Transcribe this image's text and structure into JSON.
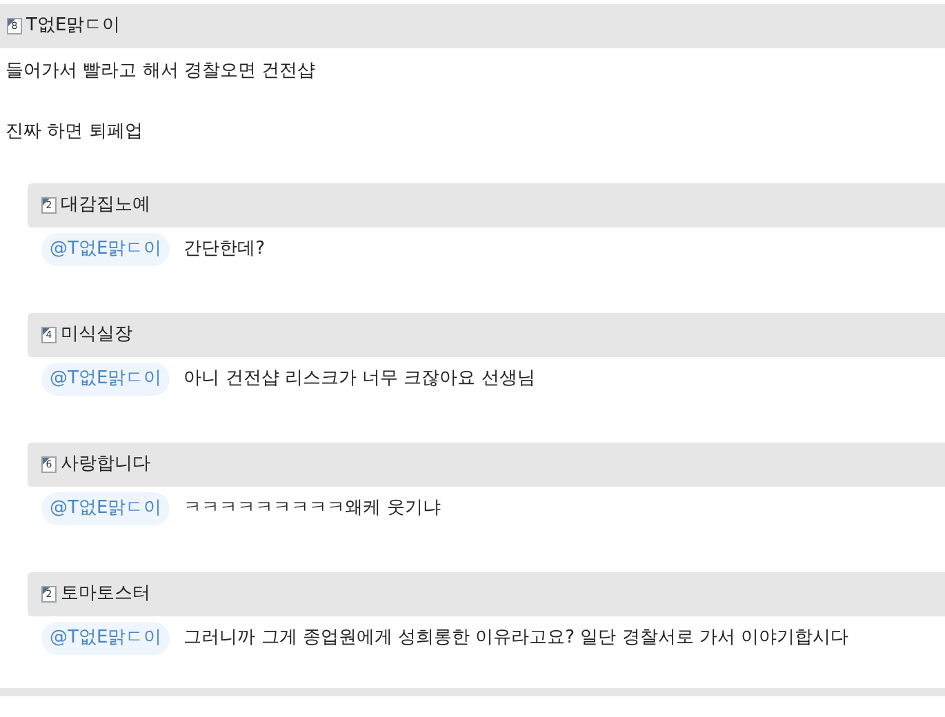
{
  "post": {
    "author": "T없E맑ㄷ이",
    "badge": "8",
    "lines": [
      "들어가서 빨라고 해서 경찰오면 건전샵",
      "진짜 하면 퇴페업"
    ]
  },
  "replies": [
    {
      "author": "대감집노예",
      "badge": "2",
      "mention": "@T없E맑ㄷ이",
      "text": "간단한데?"
    },
    {
      "author": "미식실장",
      "badge": "4",
      "mention": "@T없E맑ㄷ이",
      "text": "아니 건전샵 리스크가 너무 크잖아요 선생님"
    },
    {
      "author": "사랑합니다",
      "badge": "6",
      "mention": "@T없E맑ㄷ이",
      "text": "ㅋㅋㅋㅋㅋㅋㅋㅋㅋ왜케 웃기냐"
    },
    {
      "author": "토마토스터",
      "badge": "2",
      "mention": "@T없E맑ㄷ이",
      "text": "그러니까 그게 종업원에게 성희롱한 이유라고요? 일단 경찰서로 가서 이야기합시다"
    }
  ]
}
